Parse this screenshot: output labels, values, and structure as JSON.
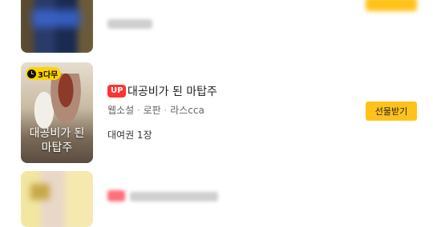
{
  "main_item": {
    "cover_badge": "3다무",
    "cover_title_line1": "대공비가 된",
    "cover_title_line2": "마탑주",
    "up_badge": "UP",
    "title": "대공비가 된 마탑주",
    "genre": "웹소설",
    "category": "로판",
    "author": "라스cca",
    "separator": "·",
    "ticket_text": "대여권 1장",
    "gift_button": "선물받기"
  },
  "colors": {
    "accent_yellow": "#ffc21a",
    "up_red": "#ff3333",
    "badge_yellow": "#ffd400"
  },
  "icons": {
    "wait_free_icon": "clock"
  }
}
